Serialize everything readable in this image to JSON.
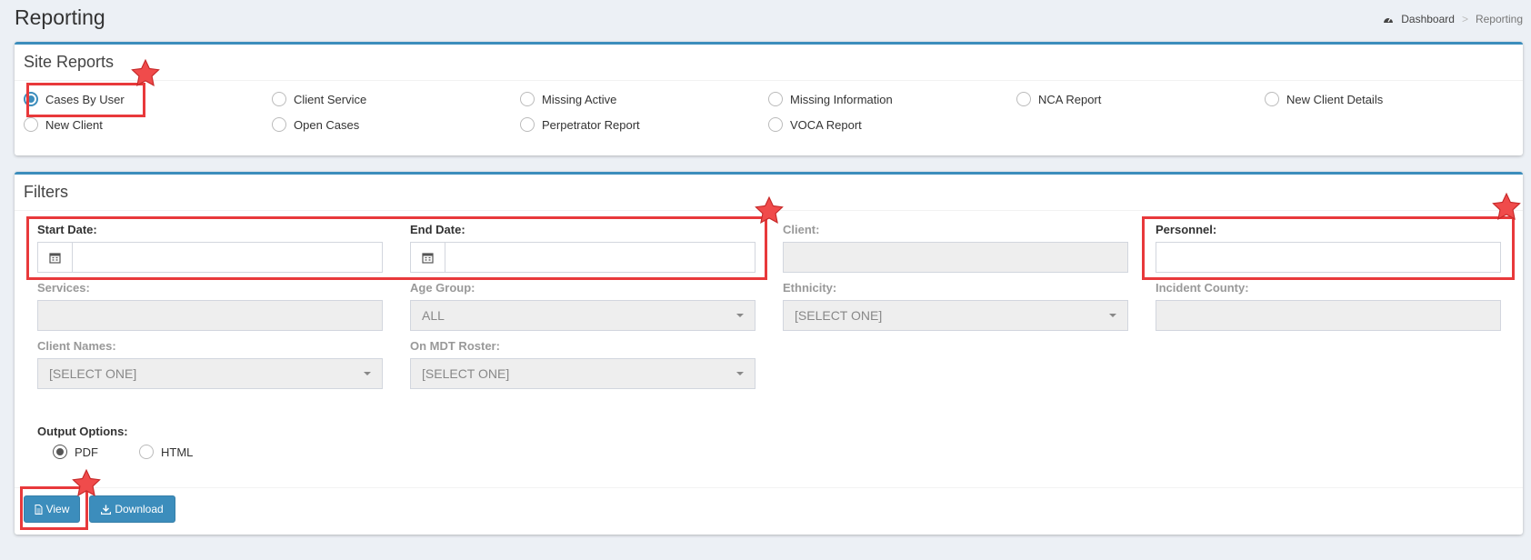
{
  "header": {
    "title": "Reporting"
  },
  "breadcrumb": {
    "home": "Dashboard",
    "separator": ">",
    "current": "Reporting"
  },
  "site_reports": {
    "title": "Site Reports",
    "items": [
      {
        "label": "Cases By User",
        "checked": true
      },
      {
        "label": "Client Service",
        "checked": false
      },
      {
        "label": "Missing Active",
        "checked": false
      },
      {
        "label": "Missing Information",
        "checked": false
      },
      {
        "label": "NCA Report",
        "checked": false
      },
      {
        "label": "New Client Details",
        "checked": false
      },
      {
        "label": "New Client",
        "checked": false
      },
      {
        "label": "Open Cases",
        "checked": false
      },
      {
        "label": "Perpetrator Report",
        "checked": false
      },
      {
        "label": "VOCA Report",
        "checked": false
      }
    ]
  },
  "filters": {
    "title": "Filters",
    "start_date": {
      "label": "Start Date:",
      "value": ""
    },
    "end_date": {
      "label": "End Date:",
      "value": ""
    },
    "client": {
      "label": "Client:",
      "value": ""
    },
    "personnel": {
      "label": "Personnel:",
      "value": ""
    },
    "services": {
      "label": "Services:",
      "value": ""
    },
    "age_group": {
      "label": "Age Group:",
      "value": "ALL"
    },
    "ethnicity": {
      "label": "Ethnicity:",
      "value": "[SELECT ONE]"
    },
    "incident_county": {
      "label": "Incident County:",
      "value": ""
    },
    "client_names": {
      "label": "Client Names:",
      "value": "[SELECT ONE]"
    },
    "on_mdt_roster": {
      "label": "On MDT Roster:",
      "value": "[SELECT ONE]"
    },
    "output_options": {
      "label": "Output Options:",
      "pdf": "PDF",
      "html": "HTML",
      "selected": "PDF"
    }
  },
  "actions": {
    "view_label": "View",
    "download_label": "Download"
  },
  "colors": {
    "accent": "#3c8dbc",
    "highlight": "#e8393b",
    "star": "#f04b4b"
  },
  "icons": [
    "dashboard-icon",
    "calendar-icon",
    "file-icon",
    "download-icon",
    "star-marker-icon"
  ]
}
